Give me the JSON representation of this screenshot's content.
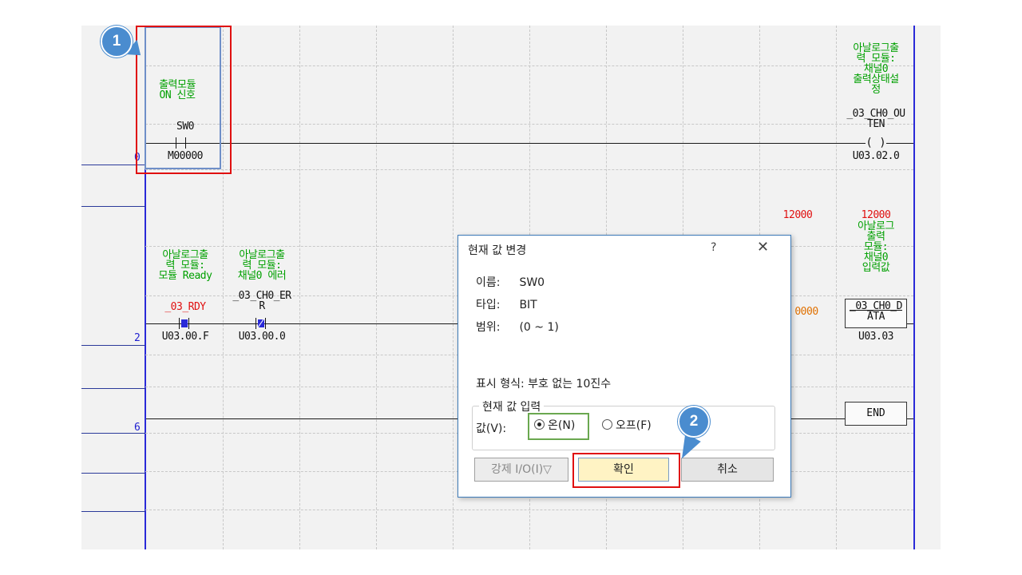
{
  "ladder": {
    "steps": [
      "0",
      "2",
      "6"
    ],
    "rung0": {
      "contact": {
        "comment_line1": "출력모듈",
        "comment_line2": "ON 신호",
        "name": "SW0",
        "address": "M00000"
      },
      "coil": {
        "comment_lines": [
          "아날로그출",
          "력 모듈:",
          "채널0",
          "출력상태설",
          "정"
        ],
        "name_line1": "_03_CH0_OU",
        "name_line2": "TEN",
        "address": "U03.02.0"
      }
    },
    "rung2": {
      "contact1": {
        "comment_line1": "아날로그출",
        "comment_line2": "력 모듈:",
        "comment_line3": "모듈 Ready",
        "name": "_03_RDY",
        "address": "U03.00.F"
      },
      "contact2": {
        "comment_line1": "아날로그출",
        "comment_line2": "력 모듈:",
        "comment_line3": "채널0 에러",
        "name_line1": "_03_CH0_ER",
        "name_line2": "R",
        "address": "U03.00.0"
      },
      "mov_value": "12000",
      "mov_value_partial": "0000",
      "dest": {
        "value": "12000",
        "comment_lines": [
          "아날로그",
          "출력",
          "모듈:",
          "채널0",
          "입력값"
        ],
        "name_line1": "_03_CH0_D",
        "name_line2": "ATA",
        "address": "U03.03"
      }
    },
    "rung6": {
      "end_label": "END"
    }
  },
  "callouts": {
    "one": "1",
    "two": "2"
  },
  "dialog": {
    "title": "현재 값 변경",
    "help": "?",
    "close": "✕",
    "name_label": "이름:",
    "name_value": "SW0",
    "type_label": "타입:",
    "type_value": "BIT",
    "range_label": "범위:",
    "range_value": "(0 ~ 1)",
    "display_format": "표시 형식: 부호 없는 10진수",
    "group_title": "현재 값 입력",
    "value_label": "값(V):",
    "radio_on": "온(N)",
    "radio_off": "오프(F)",
    "force_button": "강제 I/O(I)▽",
    "ok_button": "확인",
    "cancel_button": "취소"
  },
  "colors": {
    "comment": "#00a000",
    "highlight_red": "#e01010",
    "accent_blue": "#4a8ccf",
    "ok_fill": "#fff3c4"
  }
}
